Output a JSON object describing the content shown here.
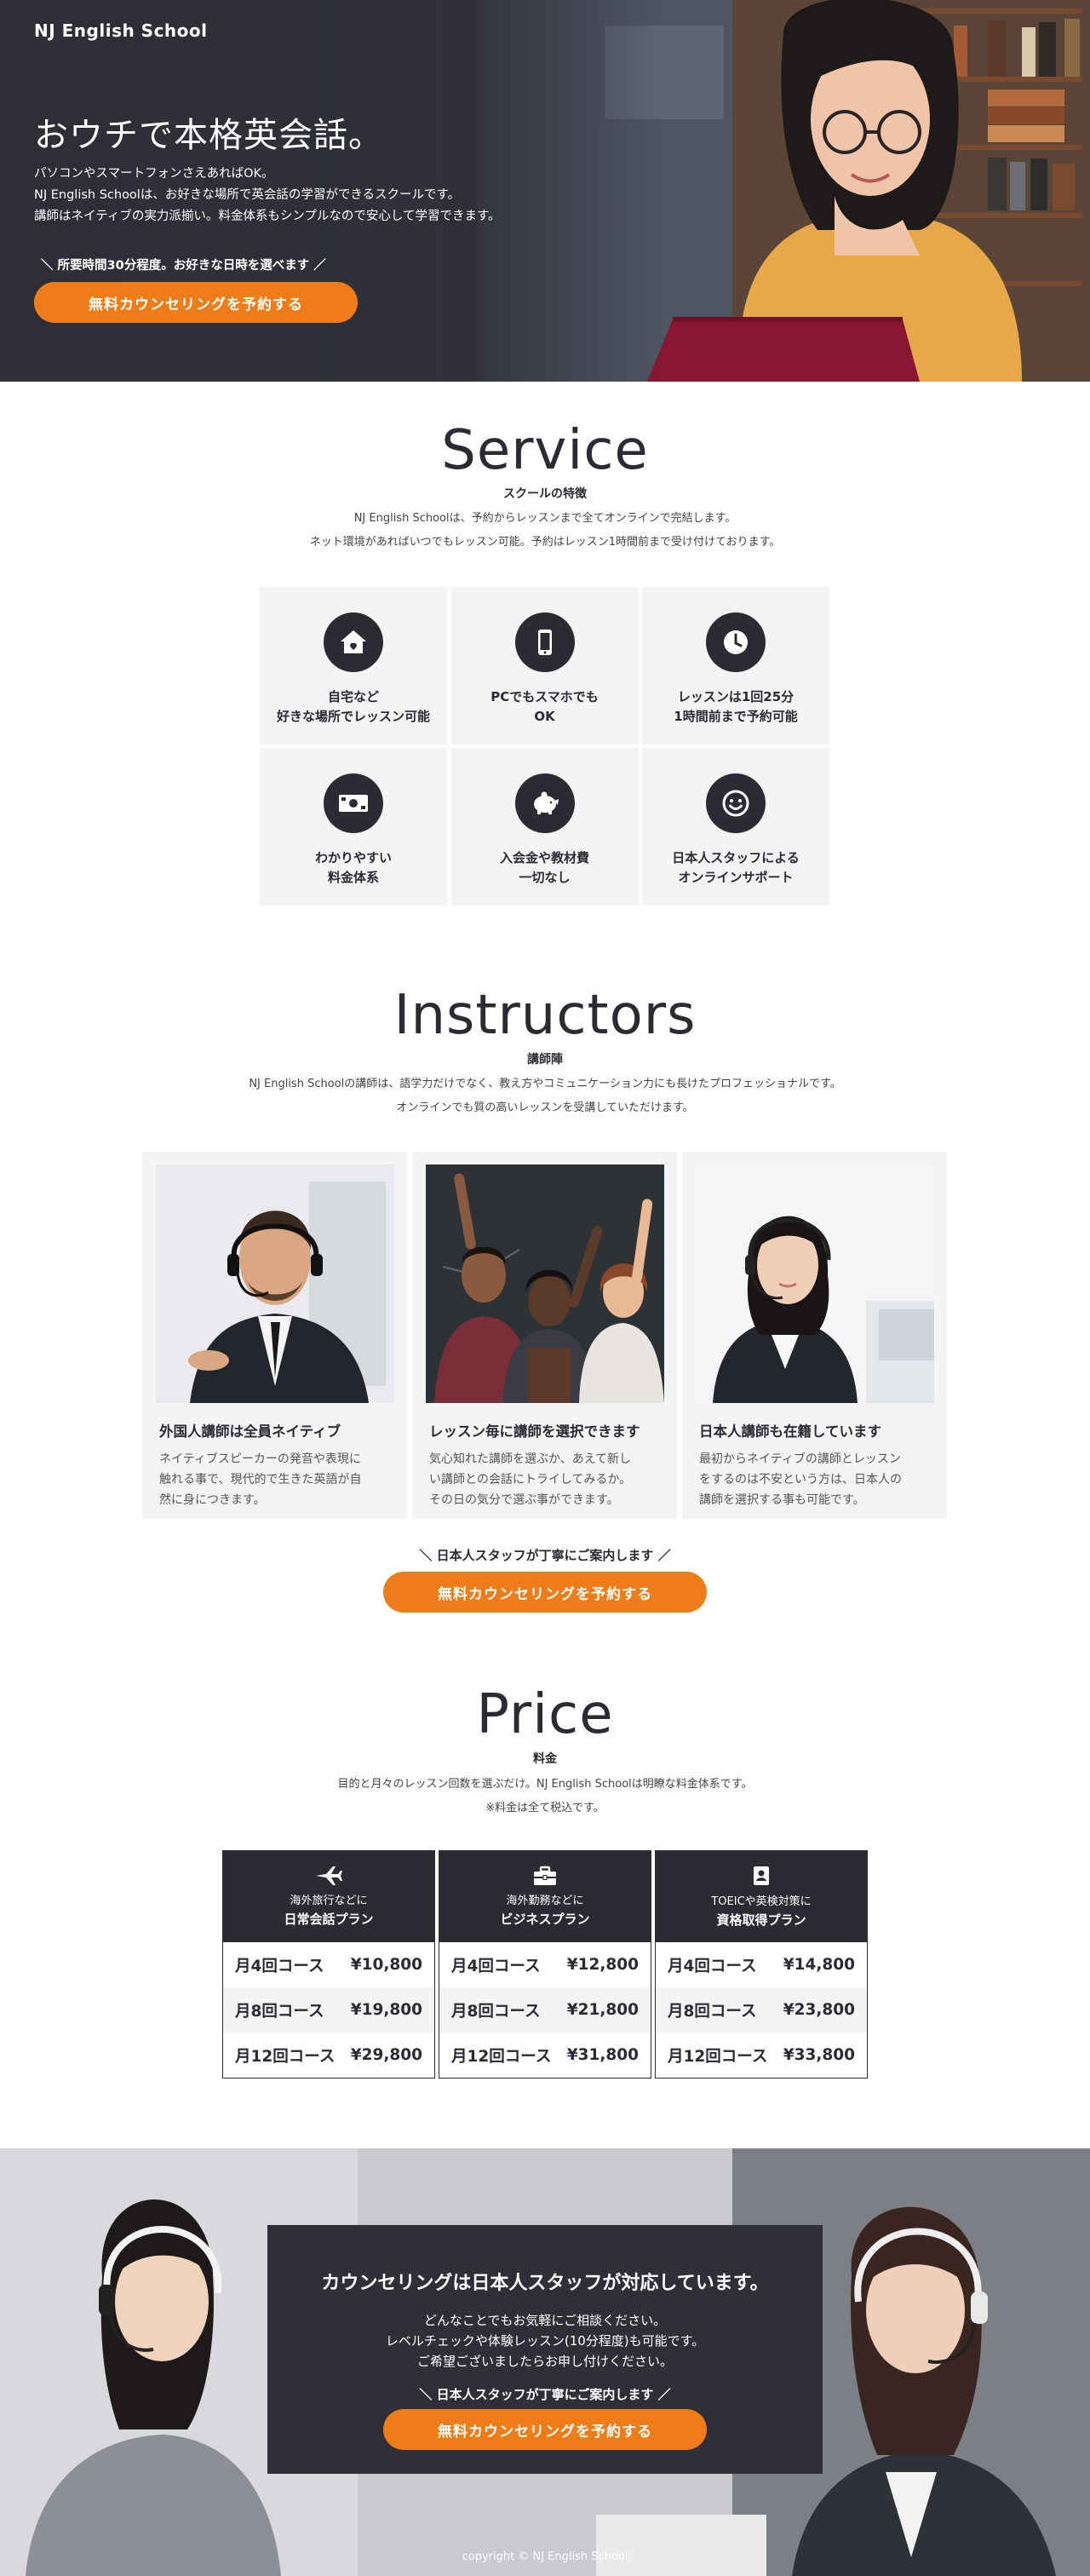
{
  "brand": {
    "logo": "NJ English School",
    "accent": "#ee7d19",
    "dark": "#2b2b33"
  },
  "hero": {
    "title": "おウチで本格英会話。",
    "desc": [
      "パソコンやスマートフォンさえあればOK。",
      "NJ English Schoolは、お好きな場所で英会話の学習ができるスクールです。",
      "講師はネイティブの実力派揃い。料金体系もシンプルなので安心して学習できます。"
    ],
    "note": "＼ 所要時間30分程度。お好きな日時を選べます ／",
    "cta": "無料カウンセリングを予約する"
  },
  "service": {
    "title": "Service",
    "subtitle": "スクールの特徴",
    "desc": [
      "NJ English Schoolは、予約からレッスンまで全てオンラインで完結します。",
      "ネット環境があればいつでもレッスン可能。予約はレッスン1時間前まで受け付けております。"
    ],
    "items": [
      {
        "icon": "house-icon",
        "text": "自宅など\n好きな場所でレッスン可能"
      },
      {
        "icon": "smartphone-icon",
        "text": "PCでもスマホでも\nOK"
      },
      {
        "icon": "clock-icon",
        "text": "レッスンは1回25分\n1時間前まで予約可能"
      },
      {
        "icon": "money-icon",
        "text": "わかりやすい\n料金体系"
      },
      {
        "icon": "piggy-bank-icon",
        "text": "入会金や教材費\n一切なし"
      },
      {
        "icon": "smile-icon",
        "text": "日本人スタッフによる\nオンラインサポート"
      }
    ]
  },
  "instructors": {
    "title": "Instructors",
    "subtitle": "講師陣",
    "desc": [
      "NJ English Schoolの講師は、語学力だけでなく、教え方やコミュニケーション力にも長けたプロフェッショナルです。",
      "オンラインでも質の高いレッスンを受講していただけます。"
    ],
    "cards": [
      {
        "name": "外国人講師は全員ネイティブ",
        "text": "ネイティブスピーカーの発音や表現に\n触れる事で、現代的で生きた英語が自\n然に身につきます。"
      },
      {
        "name": "レッスン毎に講師を選択できます",
        "text": "気心知れた講師を選ぶか、あえて新し\nい講師との会話にトライしてみるか。\nその日の気分で選ぶ事ができます。"
      },
      {
        "name": "日本人講師も在籍しています",
        "text": "最初からネイティブの講師とレッスン\nをするのは不安という方は、日本人の\n講師を選択する事も可能です。"
      }
    ],
    "note": "＼ 日本人スタッフが丁寧にご案内します ／",
    "cta": "無料カウンセリングを予約する"
  },
  "price": {
    "title": "Price",
    "subtitle": "料金",
    "desc": [
      "目的と月々のレッスン回数を選ぶだけ。NJ English Schoolは明瞭な料金体系です。",
      "※料金は全て税込です。"
    ],
    "plans": [
      {
        "icon": "airplane-icon",
        "pre": "海外旅行などに",
        "name": "日常会話プラン",
        "rows": [
          {
            "course": "月4回コース",
            "price": "¥10,800"
          },
          {
            "course": "月8回コース",
            "price": "¥19,800"
          },
          {
            "course": "月12回コース",
            "price": "¥29,800"
          }
        ]
      },
      {
        "icon": "briefcase-icon",
        "pre": "海外勤務などに",
        "name": "ビジネスプラン",
        "rows": [
          {
            "course": "月4回コース",
            "price": "¥12,800"
          },
          {
            "course": "月8回コース",
            "price": "¥21,800"
          },
          {
            "course": "月12回コース",
            "price": "¥31,800"
          }
        ]
      },
      {
        "icon": "id-badge-icon",
        "pre": "TOEICや英検対策に",
        "name": "資格取得プラン",
        "rows": [
          {
            "course": "月4回コース",
            "price": "¥14,800"
          },
          {
            "course": "月8回コース",
            "price": "¥23,800"
          },
          {
            "course": "月12回コース",
            "price": "¥33,800"
          }
        ]
      }
    ]
  },
  "banner": {
    "title": "カウンセリングは日本人スタッフが対応しています。",
    "desc": "どんなことでもお気軽にご相談ください。\nレベルチェックや体験レッスン(10分程度)も可能です。\nご希望ございましたらお申し付けください。",
    "note": "＼ 日本人スタッフが丁寧にご案内します ／",
    "cta": "無料カウンセリングを予約する"
  },
  "footer": {
    "copyright": "copyright © NJ English School"
  }
}
